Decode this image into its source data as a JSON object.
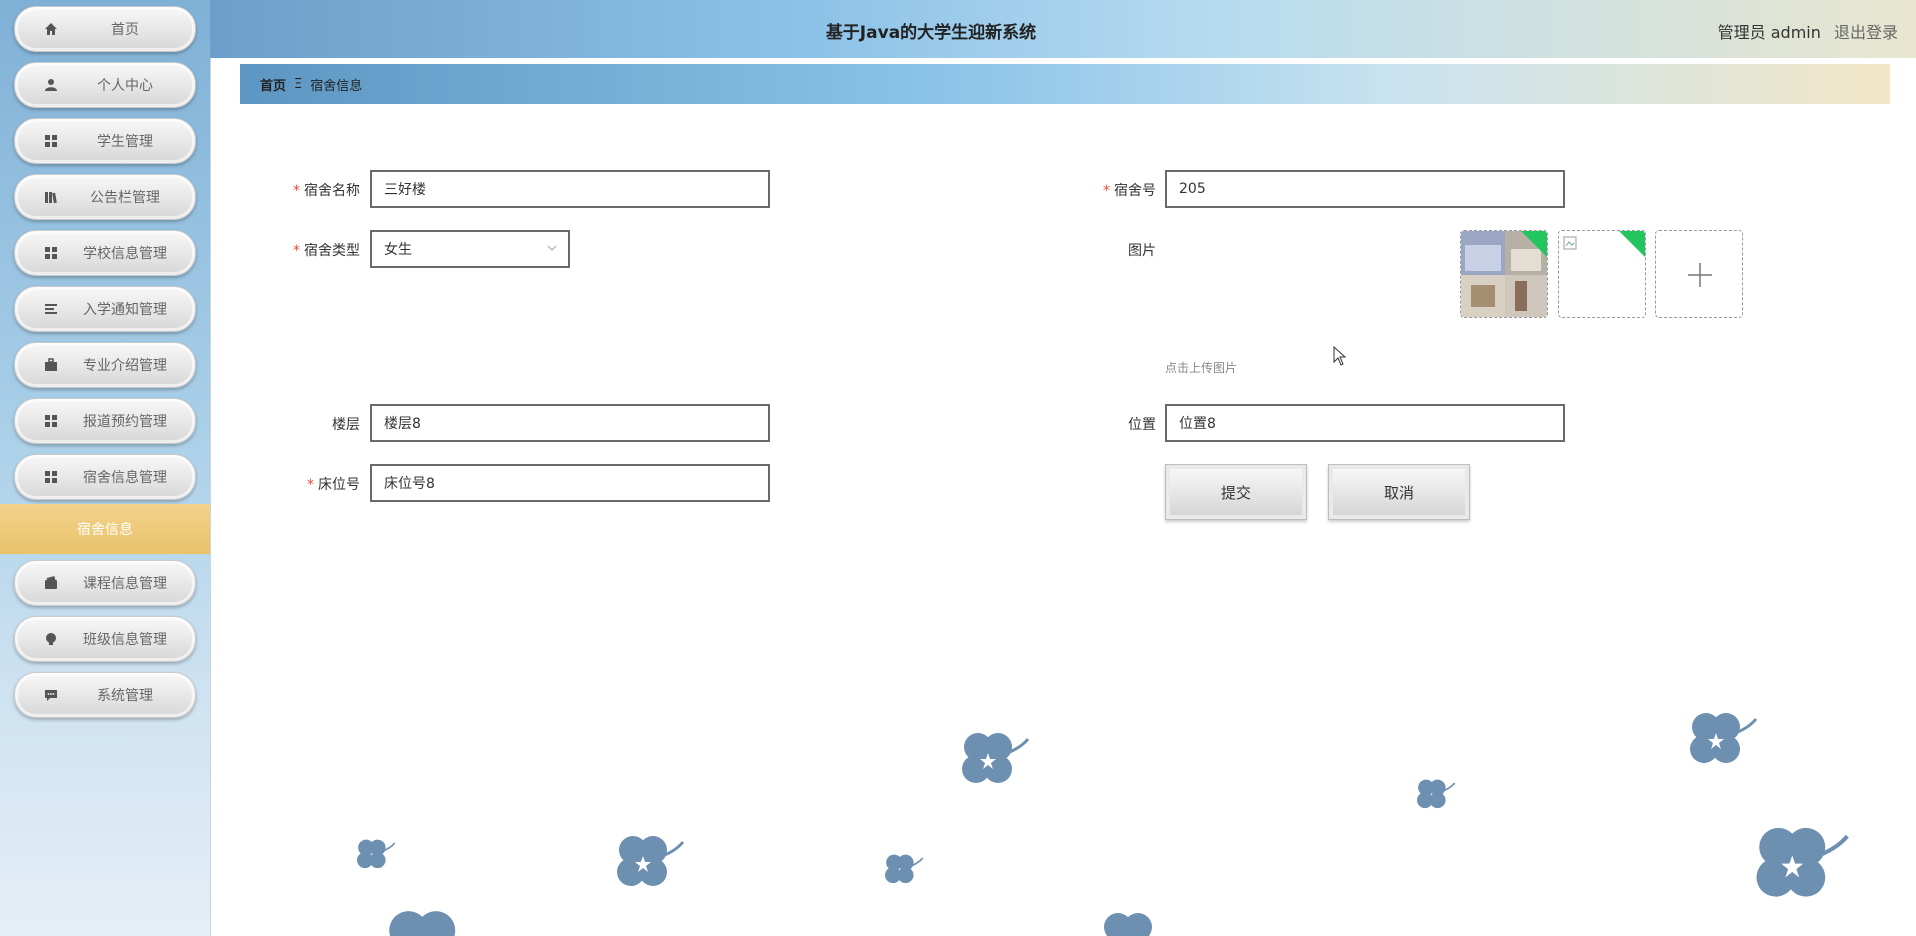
{
  "header": {
    "title": "基于Java的大学生迎新系统",
    "user_label": "管理员 admin",
    "logout_label": "退出登录"
  },
  "sidebar": {
    "items": [
      {
        "label": "首页",
        "icon": "home-icon"
      },
      {
        "label": "个人中心",
        "icon": "user-icon"
      },
      {
        "label": "学生管理",
        "icon": "grid-icon"
      },
      {
        "label": "公告栏管理",
        "icon": "book-icon"
      },
      {
        "label": "学校信息管理",
        "icon": "grid-icon"
      },
      {
        "label": "入学通知管理",
        "icon": "list-icon"
      },
      {
        "label": "专业介绍管理",
        "icon": "briefcase-icon"
      },
      {
        "label": "报道预约管理",
        "icon": "grid-icon"
      },
      {
        "label": "宿舍信息管理",
        "icon": "grid-icon"
      }
    ],
    "active_sub": "宿舍信息",
    "items_after": [
      {
        "label": "课程信息管理",
        "icon": "wallet-icon"
      },
      {
        "label": "班级信息管理",
        "icon": "bulb-icon"
      },
      {
        "label": "系统管理",
        "icon": "chat-icon"
      }
    ]
  },
  "breadcrumb": {
    "home": "首页",
    "separator": "Ξ",
    "current": "宿舍信息"
  },
  "form": {
    "dorm_name": {
      "label": "宿舍名称",
      "value": "三好楼",
      "required": true
    },
    "dorm_no": {
      "label": "宿舍号",
      "value": "205",
      "required": true
    },
    "dorm_type": {
      "label": "宿舍类型",
      "value": "女生",
      "required": true
    },
    "image": {
      "label": "图片",
      "hint": "点击上传图片"
    },
    "floor": {
      "label": "楼层",
      "value": "楼层8"
    },
    "location": {
      "label": "位置",
      "value": "位置8"
    },
    "bed_no": {
      "label": "床位号",
      "value": "床位号8",
      "required": true
    },
    "submit_label": "提交",
    "cancel_label": "取消",
    "required_mark": "*"
  },
  "colors": {
    "sidebar_active": "#e9c26a",
    "required": "#e74c3c",
    "upload_success": "#22c55e",
    "flower": "#6d8fb0"
  }
}
